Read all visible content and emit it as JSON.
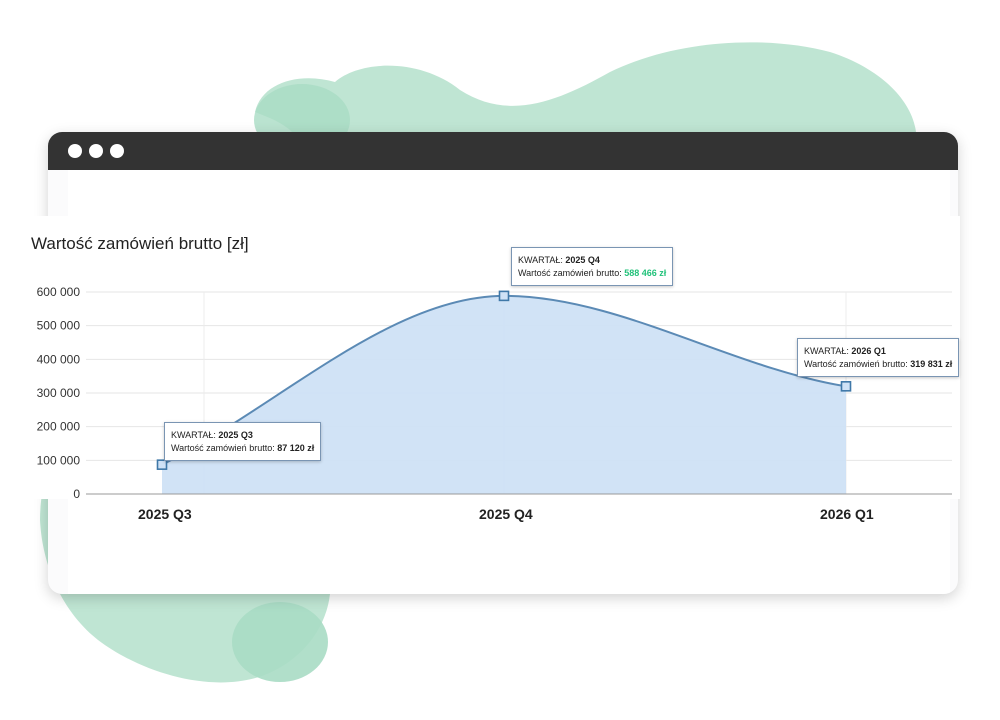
{
  "title": "Wartość zamówień brutto [zł]",
  "colors": {
    "accent_green": "#22c27a",
    "line": "#5b8ab5",
    "fill": "#cfe2f6",
    "blob": "#b9e3cf",
    "window_bar": "#333333"
  },
  "window": {
    "buttons": [
      "window-dot",
      "window-dot",
      "window-dot"
    ]
  },
  "chart_data": {
    "type": "area",
    "title": "Wartość zamówień brutto [zł]",
    "categories": [
      "2025 Q3",
      "2025 Q4",
      "2026 Q1"
    ],
    "series": [
      {
        "values": [
          87120,
          588466,
          319831
        ]
      }
    ],
    "ylim": [
      0,
      600000
    ],
    "y_ticks": [
      "0",
      "100 000",
      "200 000",
      "300 000",
      "400 000",
      "500 000",
      "600 000"
    ],
    "grid": true,
    "legend": "none"
  },
  "tooltips": [
    {
      "label": "KWARTAŁ:",
      "period": "2025 Q3",
      "value_label": "Wartość zamówień brutto:",
      "value": "87 120 zł",
      "highlight": false
    },
    {
      "label": "KWARTAŁ:",
      "period": "2025 Q4",
      "value_label": "Wartość zamówień brutto:",
      "value": "588 466 zł",
      "highlight": true
    },
    {
      "label": "KWARTAŁ:",
      "period": "2026 Q1",
      "value_label": "Wartość zamówień brutto:",
      "value": "319 831 zł",
      "highlight": false
    }
  ]
}
